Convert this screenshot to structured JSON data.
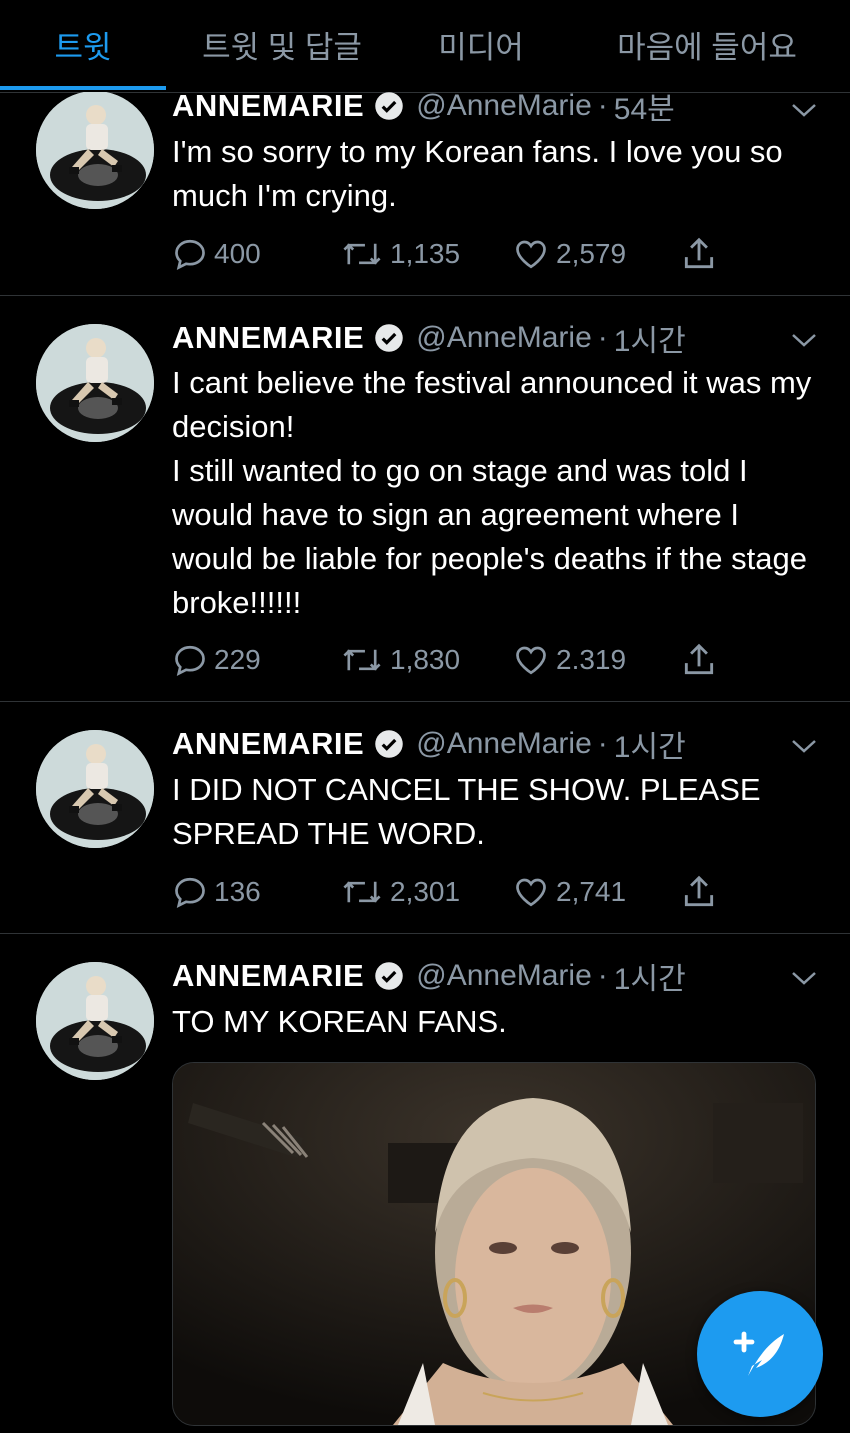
{
  "tabs": [
    {
      "label": "트윗"
    },
    {
      "label": "트윗 및 답글"
    },
    {
      "label": "미디어"
    },
    {
      "label": "마음에 들어요"
    }
  ],
  "tweets": [
    {
      "name": "ANNEMARIE",
      "handle": "@AnneMarie",
      "time": "54분",
      "text": "I'm so sorry to my Korean fans. I love you so much I'm crying.",
      "replies": "400",
      "retweets": "1,135",
      "likes": "2,579"
    },
    {
      "name": "ANNEMARIE",
      "handle": "@AnneMarie",
      "time": "1시간",
      "text": "I cant believe the festival announced it was my decision!\nI still wanted to go on stage and was told I would have to sign an agreement where I would be liable for people's deaths if the stage broke!!!!!!",
      "replies": "229",
      "retweets": "1,830",
      "likes": "2.319"
    },
    {
      "name": "ANNEMARIE",
      "handle": "@AnneMarie",
      "time": "1시간",
      "text": "I DID NOT CANCEL THE SHOW. PLEASE SPREAD THE WORD.",
      "replies": "136",
      "retweets": "2,301",
      "likes": "2,741"
    },
    {
      "name": "ANNEMARIE",
      "handle": "@AnneMarie",
      "time": "1시간",
      "text": "TO MY KOREAN FANS."
    }
  ],
  "icons": {
    "reply": "reply-icon",
    "retweet": "retweet-icon",
    "like": "heart-icon",
    "share": "share-icon",
    "verified": "verified-badge-icon",
    "more": "chevron-down-icon",
    "compose": "compose-tweet-icon"
  },
  "colors": {
    "accent": "#1d9bf0",
    "muted": "#8b98a5",
    "divider": "#2f3336",
    "background": "#000000"
  }
}
